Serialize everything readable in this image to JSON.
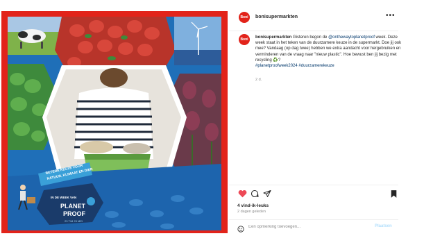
{
  "colors": {
    "brand_red": "#e2231a",
    "link": "#00376b",
    "muted": "#8e8e8e",
    "like_red": "#ed4956"
  },
  "media": {
    "badge_lines": [
      "BETERE KEUZE VOOR",
      "NATUUR, KLIMAAT EN DIER"
    ],
    "badge_top": "IN DE WEEK VAN",
    "logo_text": [
      "PLANET",
      "PROOF"
    ],
    "dates": "23 T/M 29 MEI"
  },
  "header": {
    "avatar_text": "Boni",
    "username": "bonisupermarkten",
    "more_icon": "more-horizontal-icon"
  },
  "caption": {
    "username": "bonisupermarkten",
    "text_1": " Gisteren begon de ",
    "mention": "@onthewaytoplanetproof",
    "text_2": " week. Deze week staat in het teken van de duurzamere keuze in de supermarkt. Doe jij ook mee? Vandaag (op dag twee) hebben we extra aandacht voor hergebruiken en verminderen van de vraag naar \"nieuw plastic\". Hoe bewust ben jij bezig met recycling ♻️?",
    "hashtag_1": "#planetproofweek2024",
    "hashtag_2": "#duurzamerekeuze",
    "age": "2 d."
  },
  "actions": {
    "like_icon": "heart-filled-icon",
    "comment_icon": "comment-icon",
    "share_icon": "send-icon",
    "save_icon": "bookmark-icon"
  },
  "likes": "4 vind-ik-leuks",
  "time_ago": "2 dagen geleden",
  "comment": {
    "placeholder": "Een opmerking toevoegen...",
    "post_label": "Plaatsen",
    "emoji_icon": "emoji-icon"
  }
}
